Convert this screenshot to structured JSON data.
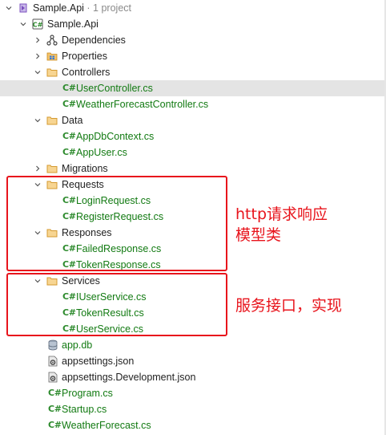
{
  "solution": {
    "name": "Sample.Api",
    "meta": " · 1 project"
  },
  "project": {
    "name": "Sample.Api",
    "badge": "C#"
  },
  "nodes": {
    "dependencies": "Dependencies",
    "properties": "Properties",
    "controllers": "Controllers",
    "user_controller": "UserController.cs",
    "weather_controller": "WeatherForecastController.cs",
    "data": "Data",
    "app_db_context": "AppDbContext.cs",
    "app_user": "AppUser.cs",
    "migrations": "Migrations",
    "requests": "Requests",
    "login_request": "LoginRequest.cs",
    "register_request": "RegisterRequest.cs",
    "responses": "Responses",
    "failed_response": "FailedResponse.cs",
    "token_response": "TokenResponse.cs",
    "services": "Services",
    "iuser_service": "IUserService.cs",
    "token_result": "TokenResult.cs",
    "user_service": "UserService.cs",
    "app_db": "app.db",
    "appsettings": "appsettings.json",
    "appsettings_dev": "appsettings.Development.json",
    "program": "Program.cs",
    "startup": "Startup.cs",
    "weather_forecast": "WeatherForecast.cs"
  },
  "cs_badge": "C#",
  "annotations": {
    "http_line1": "http请求响应",
    "http_line2": "模型类",
    "services": "服务接口，实现"
  },
  "colors": {
    "annotation": "#e8141c",
    "cs_badge": "#2e8b2e",
    "folder": "#e8a33d",
    "selected_row": "#e4e4e4"
  },
  "selected": "UserController.cs"
}
